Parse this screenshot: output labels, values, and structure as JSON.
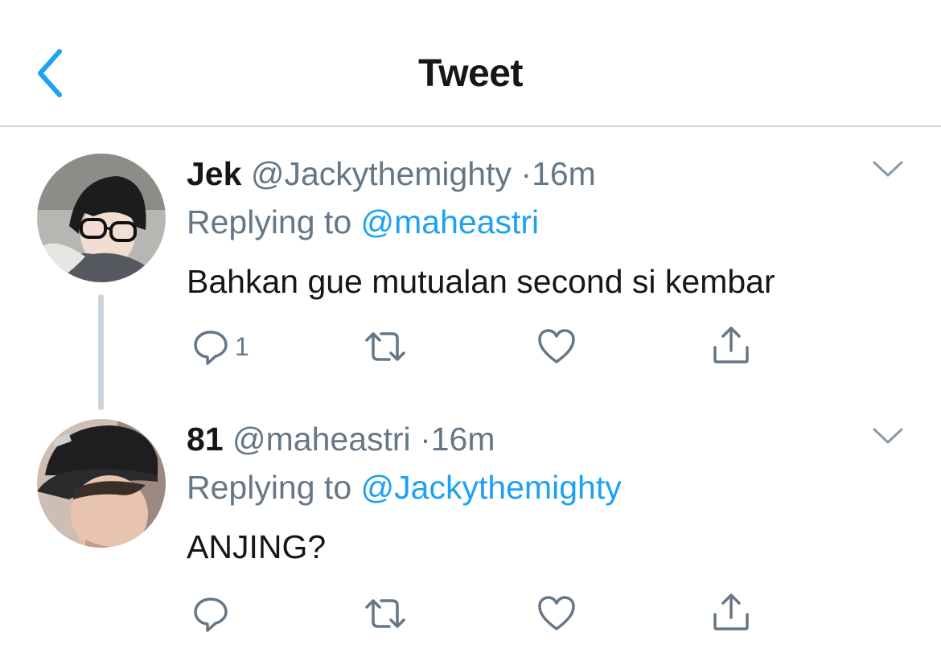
{
  "header": {
    "title": "Tweet",
    "back_icon": "chevron-left-icon"
  },
  "colors": {
    "accent": "#1da1f2",
    "secondary_text": "#657786",
    "primary_text": "#14171a",
    "divider": "#cfd5da"
  },
  "tweets": [
    {
      "name": "Jek",
      "handle": "@Jackythemighty",
      "separator": "·",
      "time": "16m",
      "replying_prefix": "Replying to",
      "replying_to": "@maheastri",
      "text": "Bahkan gue mutualan second si kembar",
      "reply_count": "1",
      "icons": [
        "reply-icon",
        "retweet-icon",
        "like-icon",
        "share-icon",
        "chevron-down-icon"
      ]
    },
    {
      "name": "81",
      "handle": "@maheastri",
      "separator": "·",
      "time": "16m",
      "replying_prefix": "Replying to",
      "replying_to": "@Jackythemighty",
      "text": "ANJING?",
      "reply_count": "",
      "icons": [
        "reply-icon",
        "retweet-icon",
        "like-icon",
        "share-icon",
        "chevron-down-icon"
      ]
    }
  ]
}
